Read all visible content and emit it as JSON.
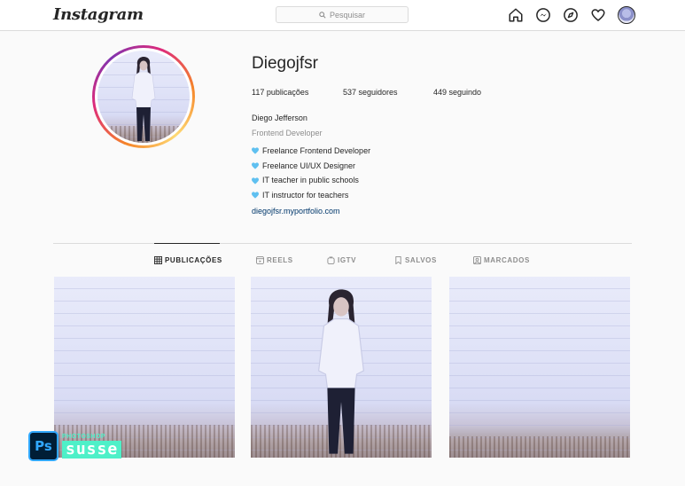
{
  "nav": {
    "logo": "Instagram",
    "search_placeholder": "Pesquisar",
    "icons": [
      "home-icon",
      "messenger-icon",
      "explore-icon",
      "heart-icon",
      "profile-avatar"
    ]
  },
  "profile": {
    "username": "Diegojfsr",
    "stats": {
      "posts": "117 publicações",
      "followers": "537 seguidores",
      "following": "449 seguindo"
    },
    "name": "Diego Jefferson",
    "category": "Frontend Developer",
    "bio": [
      "Freelance Frontend Developer",
      "Freelance UI/UX Designer",
      "IT teacher in public schools",
      "IT instructor for teachers"
    ],
    "link": "diegojfsr.myportfolio.com"
  },
  "tabs": [
    {
      "label": "PUBLICAÇÕES",
      "icon": "grid-icon",
      "active": true
    },
    {
      "label": "REELS",
      "icon": "reels-icon",
      "active": false
    },
    {
      "label": "IGTV",
      "icon": "igtv-icon",
      "active": false
    },
    {
      "label": "SALVOS",
      "icon": "bookmark-icon",
      "active": false
    },
    {
      "label": "MARCADOS",
      "icon": "tagged-icon",
      "active": false
    }
  ],
  "watermark": {
    "ps": "Ps",
    "small": "PHOTOSHOP",
    "big": "susse"
  },
  "colors": {
    "heart_emoji": "#5fc0f0",
    "link": "#00376b",
    "accent_watermark": "#4ef0c8"
  }
}
